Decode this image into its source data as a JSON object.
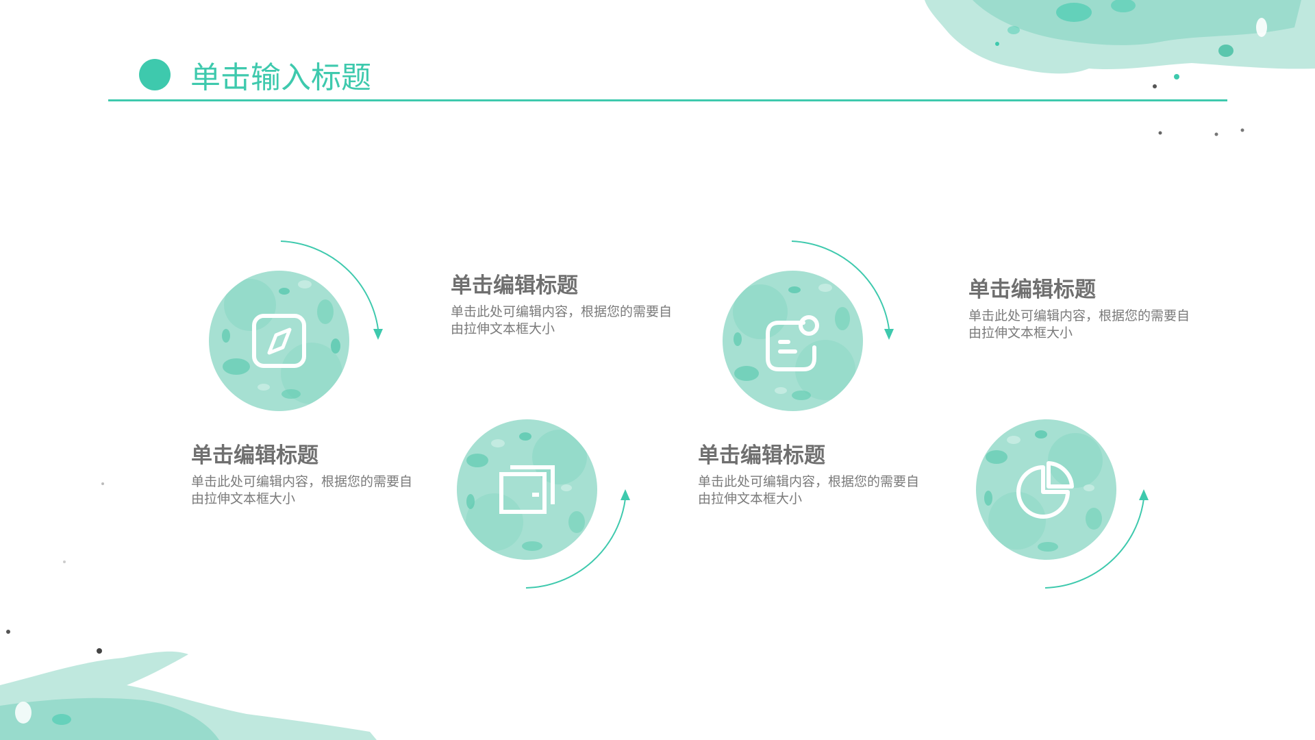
{
  "header": {
    "title": "单击输入标题"
  },
  "colors": {
    "accent": "#3ec9ad",
    "accent_light": "#a6e0d2",
    "heading_text": "#6f6f6f",
    "body_text": "#7a7a7a"
  },
  "items": [
    {
      "icon": "compass-icon",
      "heading": "单击编辑标题",
      "description": "单击此处可编辑内容，根据您的需要自由拉伸文本框大小"
    },
    {
      "icon": "wallet-icon",
      "heading": "单击编辑标题",
      "description": "单击此处可编辑内容，根据您的需要自由拉伸文本框大小"
    },
    {
      "icon": "message-notification-icon",
      "heading": "单击编辑标题",
      "description": "单击此处可编辑内容，根据您的需要自由拉伸文本框大小"
    },
    {
      "icon": "pie-chart-icon",
      "heading": "单击编辑标题",
      "description": "单击此处可编辑内容，根据您的需要自由拉伸文本框大小"
    }
  ]
}
